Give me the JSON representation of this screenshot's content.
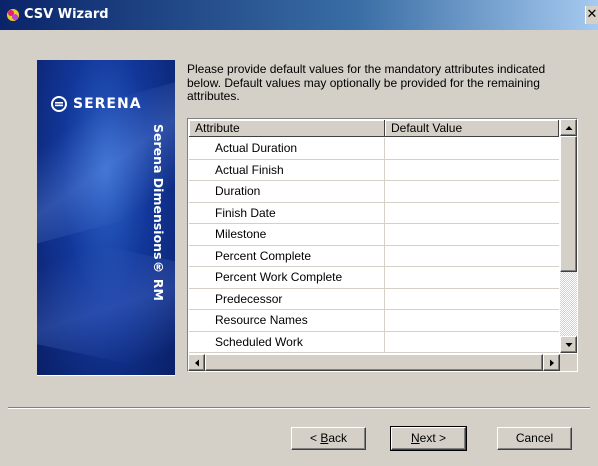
{
  "window": {
    "title": "CSV Wizard",
    "close_glyph": "✕"
  },
  "banner": {
    "logo_text": "SERENA",
    "product_text": "Serena Dimensions® RM"
  },
  "instruction": "Please provide default values for the mandatory attributes indicated below. Default values may optionally be provided for the remaining attributes.",
  "grid": {
    "columns": [
      "Attribute",
      "Default Value"
    ],
    "rows": [
      {
        "attribute": "Actual Duration",
        "default_value": ""
      },
      {
        "attribute": "Actual Finish",
        "default_value": ""
      },
      {
        "attribute": "Duration",
        "default_value": ""
      },
      {
        "attribute": "Finish Date",
        "default_value": ""
      },
      {
        "attribute": "Milestone",
        "default_value": ""
      },
      {
        "attribute": "Percent Complete",
        "default_value": ""
      },
      {
        "attribute": "Percent Work Complete",
        "default_value": ""
      },
      {
        "attribute": "Predecessor",
        "default_value": ""
      },
      {
        "attribute": "Resource Names",
        "default_value": ""
      },
      {
        "attribute": "Scheduled Work",
        "default_value": ""
      }
    ]
  },
  "buttons": {
    "back_mnemonic": "B",
    "back_rest": "ack",
    "back_prefix": "< ",
    "next_mnemonic": "N",
    "next_rest": "ext",
    "next_suffix": " >",
    "cancel": "Cancel"
  },
  "icons": {
    "app": "wizard-app-icon",
    "logo": "serena-logo-icon"
  },
  "colors": {
    "titlebar_start": "#0a246a",
    "titlebar_end": "#a6caf0",
    "banner": "#12379a",
    "face": "#d4d0c8"
  }
}
